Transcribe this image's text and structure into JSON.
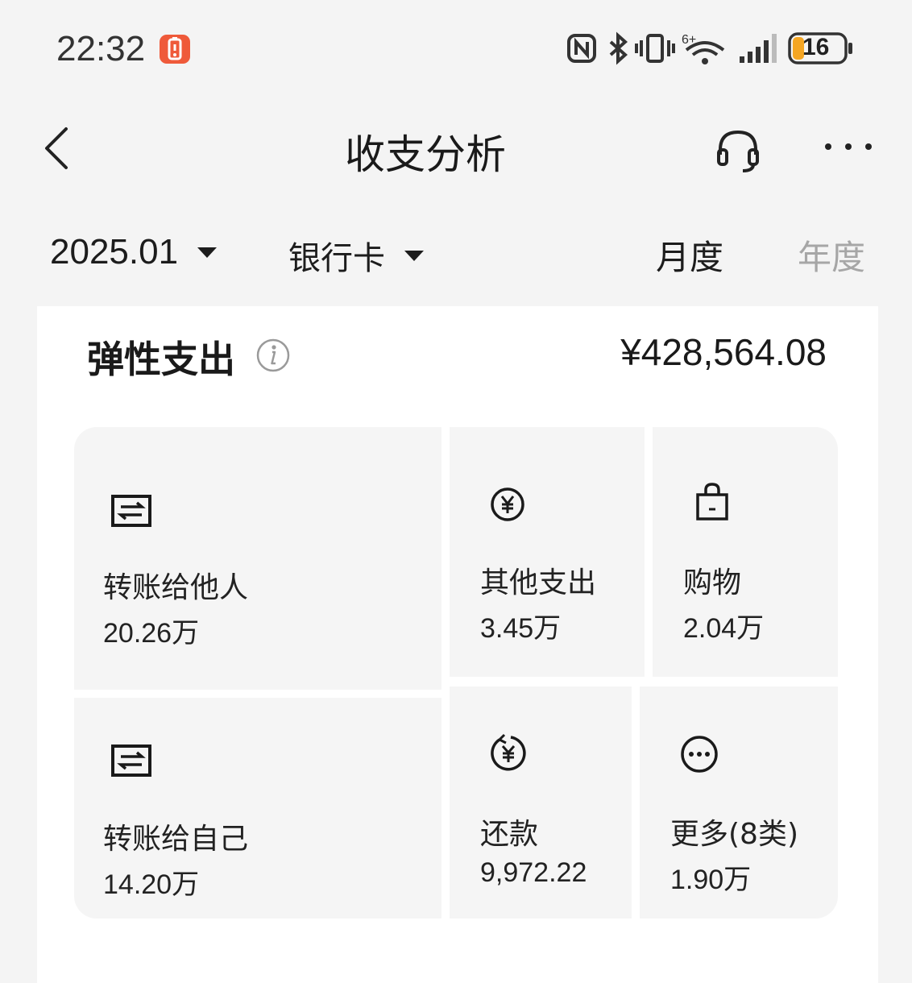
{
  "status_bar": {
    "time": "22:32",
    "battery_level": "16",
    "icons": [
      "nfc-icon",
      "bluetooth-icon",
      "vibrate-icon",
      "wifi-6-icon",
      "signal-icon",
      "battery-icon"
    ]
  },
  "header": {
    "title": "收支分析",
    "back_icon": "chevron-left-icon",
    "support_icon": "headset-icon",
    "more_icon": "more-dots-icon"
  },
  "filters": {
    "date": "2025.01",
    "account": "银行卡",
    "tabs": [
      {
        "label": "月度",
        "active": true
      },
      {
        "label": "年度",
        "active": false
      }
    ]
  },
  "card": {
    "title": "弹性支出",
    "info_icon": "info-icon",
    "total": "¥428,564.08",
    "categories": [
      {
        "label": "转账给他人",
        "value": "20.26万",
        "icon": "transfer-icon"
      },
      {
        "label": "其他支出",
        "value": "3.45万",
        "icon": "yuan-coin-icon"
      },
      {
        "label": "购物",
        "value": "2.04万",
        "icon": "shopping-bag-icon"
      },
      {
        "label": "转账给自己",
        "value": "14.20万",
        "icon": "transfer-icon"
      },
      {
        "label": "还款",
        "value": "9,972.22",
        "icon": "repay-icon"
      },
      {
        "label": "更多(8类)",
        "value": "1.90万",
        "icon": "more-circle-icon"
      }
    ]
  },
  "colors": {
    "background": "#f4f4f4",
    "card": "#ffffff",
    "tile": "#f5f5f5",
    "text": "#1a1a1a",
    "inactive_tab": "#a6a6a6",
    "alert": "#ef5a3a",
    "battery_accent": "#f5a623"
  }
}
